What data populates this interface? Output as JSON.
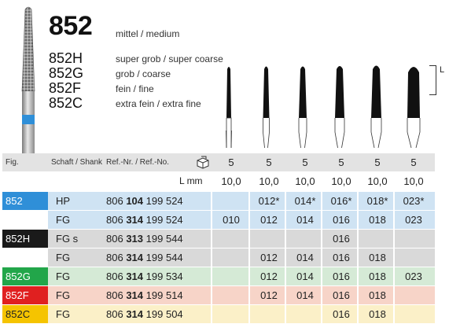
{
  "header": {
    "model": "852",
    "model_desc": "mittel / medium",
    "variants": [
      {
        "code": "852H",
        "desc": "super grob / super coarse"
      },
      {
        "code": "852G",
        "desc": "grob / coarse"
      },
      {
        "code": "852F",
        "desc": "fein / fine"
      },
      {
        "code": "852C",
        "desc": "extra fein / extra fine"
      }
    ],
    "L_label": "L"
  },
  "table": {
    "col_fig": "Fig.",
    "col_shank": "Schaft / Shank",
    "col_ref": "Ref.-Nr. / Ref.-No.",
    "pack_values": [
      "5",
      "5",
      "5",
      "5",
      "5",
      "5"
    ],
    "L_label": "L mm",
    "L_values": [
      "10,0",
      "10,0",
      "10,0",
      "10,0",
      "10,0",
      "10,0"
    ],
    "rows": [
      {
        "fig": "852",
        "shank": "HP",
        "ref_a": "806",
        "ref_b": "104",
        "ref_c": "199 524",
        "sizes": [
          "",
          "012*",
          "014*",
          "016*",
          "018*",
          "023*"
        ]
      },
      {
        "fig": "",
        "shank": "FG",
        "ref_a": "806",
        "ref_b": "314",
        "ref_c": "199 524",
        "sizes": [
          "010",
          "012",
          "014",
          "016",
          "018",
          "023"
        ]
      },
      {
        "fig": "852H",
        "shank": "FG s",
        "ref_a": "806",
        "ref_b": "313",
        "ref_c": "199 544",
        "sizes": [
          "",
          "",
          "",
          "016",
          "",
          ""
        ]
      },
      {
        "fig": "",
        "shank": "FG",
        "ref_a": "806",
        "ref_b": "314",
        "ref_c": "199 544",
        "sizes": [
          "",
          "012",
          "014",
          "016",
          "018",
          ""
        ]
      },
      {
        "fig": "852G",
        "shank": "FG",
        "ref_a": "806",
        "ref_b": "314",
        "ref_c": "199 534",
        "sizes": [
          "",
          "012",
          "014",
          "016",
          "018",
          "023"
        ]
      },
      {
        "fig": "852F",
        "shank": "FG",
        "ref_a": "806",
        "ref_b": "314",
        "ref_c": "199 514",
        "sizes": [
          "",
          "012",
          "014",
          "016",
          "018",
          ""
        ]
      },
      {
        "fig": "852C",
        "shank": "FG",
        "ref_a": "806",
        "ref_b": "314",
        "ref_c": "199 504",
        "sizes": [
          "",
          "",
          "",
          "016",
          "018",
          ""
        ]
      }
    ]
  },
  "colors": {
    "blue": "#2f8fd8",
    "blue_bg": "#cfe3f3",
    "black": "#1a1a1a",
    "gray_bg": "#d9d9d9",
    "green": "#22a64a",
    "green_bg": "#d5ead6",
    "red": "#e02020",
    "red_bg": "#f7d4c8",
    "yellow": "#f5c400",
    "yellow_bg": "#fbf0c8",
    "header_bg": "#e3e3e3"
  }
}
